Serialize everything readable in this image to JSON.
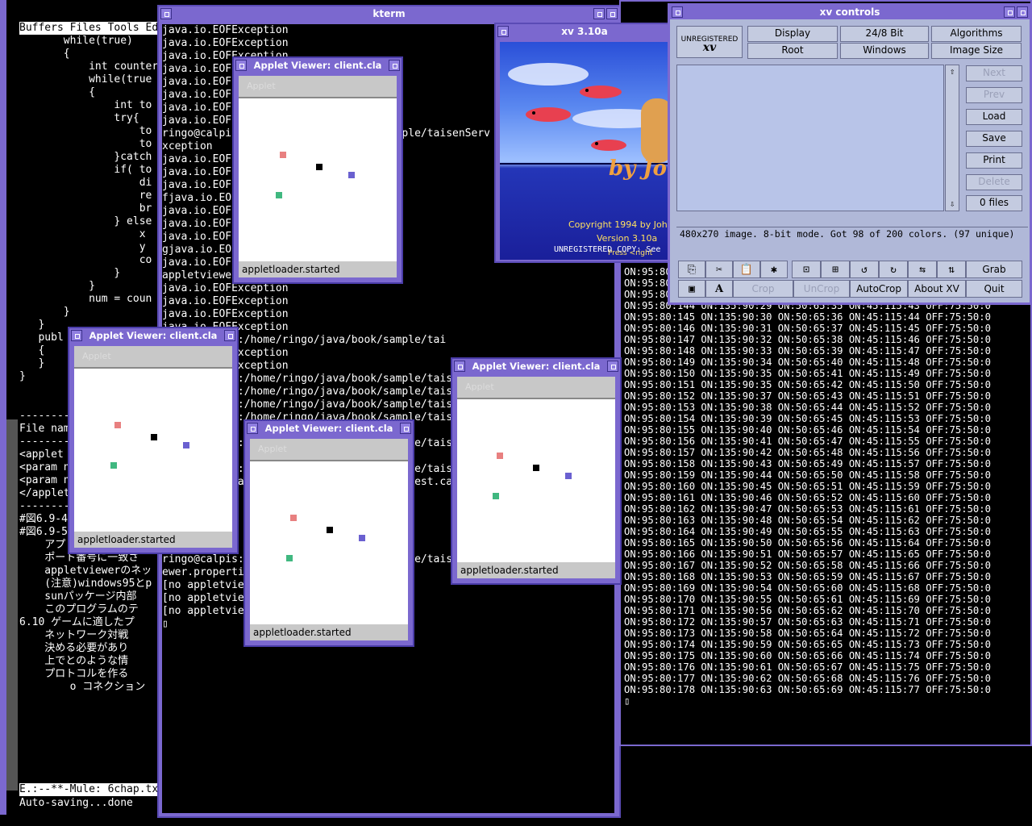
{
  "emacs": {
    "menubar": "Buffers Files Tools Edit",
    "code_lines": [
      "       while(true)",
      "       {",
      "           int counter",
      "           while(true",
      "           {",
      "               int to",
      "               try{",
      "                   to",
      "                   to",
      "               }catch",
      "",
      "               if( to",
      "                   di",
      "                   re",
      "                   br",
      "               } else",
      "                   x",
      "                   y",
      "                   co",
      "               }",
      "           }",
      "           num = coun",
      "       }",
      "   }",
      "   publ",
      "   {",
      "",
      "   }",
      "}"
    ],
    "lower_lines": [
      "----------",
      "File name",
      "----------",
      "<applet",
      "<param n",
      "<param n",
      "</applet",
      "----------",
      "#図6.9-4",
      "#図6.9-5",
      "",
      "    アプレットのparam",
      "    ポート番号に一致さ",
      "    appletviewerのネッ",
      "    (注意)windows95とp",
      "    sunパッケージ内部",
      "    このプログラムのテ",
      "",
      "",
      "",
      "6.10 ゲームに適したプ",
      "",
      "    ネットワーク対戦",
      "    決める必要があり",
      "    上でとのような情",
      "    プロトコルを作る",
      "",
      "        o コネクション"
    ],
    "modeline": "E.:--**-Mule: 6chap.tx",
    "minibuffer": "Auto-saving...done"
  },
  "kterm": {
    "title": "kterm",
    "lines": [
      "java.io.EOFException",
      "java.io.EOFException",
      "java.io.EOFException",
      "java.io.EOFException",
      "java.io.EOFException",
      "java.io.EOFException",
      "java.io.EOFException",
      "java.io.EOFException",
      "",
      "ringo@calpis:/home/ringo/java/book/sample/taisenServ",
      "xception",
      "java.io.EOFException",
      "java.io.EOFException",
      "java.io.EOFException",
      "fjava.io.EOFException",
      "java.io.EOFException",
      "java.io.EOFException",
      "java.io.EOFException",
      "gjava.io.EOFException",
      "java.io.EOFException",
      "",
      "appletviewer test.calpis.html",
      "java.io.EOFException",
      "java.io.EOFException",
      "java.io.EOFException",
      "java.io.EOFException",
      "ringo@calpis:/home/ringo/java/book/sample/tai",
      "",
      "java.io.EOFException",
      "java.io.EOFException",
      "",
      "",
      "",
      "",
      "",
      "",
      "",
      "",
      "",
      "",
      "ringo@calpis:/home/ringo/java/book/sample/taisenServCli",
      "ringo@calpis:/home/ringo/java/book/sample/taisenServCli",
      "ringo@calpis:/home/ringo/java/book/sample/taisenServCli % n client.ja",
      "ringo@calpis:/home/ringo/java/book/sample/taisenServCli % n client.ja",
      "a",
      "ringo@calpis:/home/ringo/java/book/sample/taisenServCli % jc client.j",
      "va",
      "ringo@calpis:/home/ringo/java/book/sample/taisenServCli % ap test.cal",
      "is.html & ; ap test.calpis.html & ; ap test.calpis.html & ap test.ca",
      "is.html &",
      "[1] 594",
      "[2] 595",
      "[3] 596",
      "[4] 597",
      "ringo@calpis:/home/ringo/java/book/sample/taisenServCli % [no applet",
      "ewer.properties file found!]",
      "[no appletviewer.properties file found!]",
      "[no appletviewer.properties file found!]",
      "[no appletviewer.properties file found!]",
      "▯"
    ]
  },
  "output_lines": [
    "ON:95:80:141 ON:135:90:27 ON:50:65:32 ON:45:115:40 OFF:75:50:0",
    "ON:95:80:142 ON:135:90:28 ON:50:65:33 ON:45:115:41 OFF:75:50:0",
    "ON:95:80:143 ON:135:90:29 ON:50:65:34 ON:45:115:42 OFF:75:50:0",
    "ON:95:80:144 ON:135:90:29 ON:50:65:35 ON:45:115:43 OFF:75:50:0",
    "ON:95:80:145 ON:135:90:30 ON:50:65:36 ON:45:115:44 OFF:75:50:0",
    "ON:95:80:146 ON:135:90:31 ON:50:65:37 ON:45:115:45 OFF:75:50:0",
    "ON:95:80:147 ON:135:90:32 ON:50:65:38 ON:45:115:46 OFF:75:50:0",
    "ON:95:80:148 ON:135:90:33 ON:50:65:39 ON:45:115:47 OFF:75:50:0",
    "ON:95:80:149 ON:135:90:34 ON:50:65:40 ON:45:115:48 OFF:75:50:0",
    "ON:95:80:150 ON:135:90:35 ON:50:65:41 ON:45:115:49 OFF:75:50:0",
    "ON:95:80:151 ON:135:90:35 ON:50:65:42 ON:45:115:50 OFF:75:50:0",
    "ON:95:80:152 ON:135:90:37 ON:50:65:43 ON:45:115:51 OFF:75:50:0",
    "ON:95:80:153 ON:135:90:38 ON:50:65:44 ON:45:115:52 OFF:75:50:0",
    "ON:95:80:154 ON:135:90:39 ON:50:65:45 ON:45:115:53 OFF:75:50:0",
    "ON:95:80:155 ON:135:90:40 ON:50:65:46 ON:45:115:54 OFF:75:50:0",
    "ON:95:80:156 ON:135:90:41 ON:50:65:47 ON:45:115:55 OFF:75:50:0",
    "ON:95:80:157 ON:135:90:42 ON:50:65:48 ON:45:115:56 OFF:75:50:0",
    "ON:95:80:158 ON:135:90:43 ON:50:65:49 ON:45:115:57 OFF:75:50:0",
    "ON:95:80:159 ON:135:90:44 ON:50:65:50 ON:45:115:58 OFF:75:50:0",
    "ON:95:80:160 ON:135:90:45 ON:50:65:51 ON:45:115:59 OFF:75:50:0",
    "ON:95:80:161 ON:135:90:46 ON:50:65:52 ON:45:115:60 OFF:75:50:0",
    "ON:95:80:162 ON:135:90:47 ON:50:65:53 ON:45:115:61 OFF:75:50:0",
    "ON:95:80:163 ON:135:90:48 ON:50:65:54 ON:45:115:62 OFF:75:50:0",
    "ON:95:80:164 ON:135:90:49 ON:50:65:55 ON:45:115:63 OFF:75:50:0",
    "ON:95:80:165 ON:135:90:50 ON:50:65:56 ON:45:115:64 OFF:75:50:0",
    "ON:95:80:166 ON:135:90:51 ON:50:65:57 ON:45:115:65 OFF:75:50:0",
    "ON:95:80:167 ON:135:90:52 ON:50:65:58 ON:45:115:66 OFF:75:50:0",
    "ON:95:80:168 ON:135:90:53 ON:50:65:59 ON:45:115:67 OFF:75:50:0",
    "ON:95:80:169 ON:135:90:54 ON:50:65:60 ON:45:115:68 OFF:75:50:0",
    "ON:95:80:170 ON:135:90:55 ON:50:65:61 ON:45:115:69 OFF:75:50:0",
    "ON:95:80:171 ON:135:90:56 ON:50:65:62 ON:45:115:70 OFF:75:50:0",
    "ON:95:80:172 ON:135:90:57 ON:50:65:63 ON:45:115:71 OFF:75:50:0",
    "ON:95:80:173 ON:135:90:58 ON:50:65:64 ON:45:115:72 OFF:75:50:0",
    "ON:95:80:174 ON:135:90:59 ON:50:65:65 ON:45:115:73 OFF:75:50:0",
    "ON:95:80:175 ON:135:90:60 ON:50:65:66 ON:45:115:74 OFF:75:50:0",
    "ON:95:80:176 ON:135:90:61 ON:50:65:67 ON:45:115:75 OFF:75:50:0",
    "ON:95:80:177 ON:135:90:62 ON:50:65:68 ON:45:115:76 OFF:75:50:0",
    "ON:95:80:178 ON:135:90:63 ON:50:65:69 ON:45:115:77 OFF:75:50:0",
    "▯"
  ],
  "xv_about": {
    "title": "xv 3.10a",
    "byline": "by John",
    "copyright": "Copyright 1994 by John",
    "version": "Version 3.10a",
    "press": "Press <right",
    "unregistered": "UNREGISTERED COPY:  See"
  },
  "xv_controls": {
    "title": "xv controls",
    "logo_label": "UNREGISTERED",
    "menu_buttons": [
      "Display",
      "24/8 Bit",
      "Algorithms",
      "Root",
      "Windows",
      "Image Size"
    ],
    "side_buttons": [
      "Next",
      "Prev",
      "Load",
      "Save",
      "Print",
      "Delete",
      "0 files"
    ],
    "status": "480x270 image.  8-bit mode.  Got 98 of 200 colors.  (97 unique)",
    "bottom_labels": {
      "grab": "Grab",
      "crop": "Crop",
      "uncrop": "UnCrop",
      "autocrop": "AutoCrop",
      "about": "About XV",
      "quit": "Quit",
      "text_tool": "A"
    },
    "icon_glyphs": {
      "copy": "⎘",
      "cut": "✂",
      "paste": "📋",
      "clear": "✱",
      "shrink": "⊡",
      "expand": "⊞",
      "rotl": "↺",
      "rotr": "↻",
      "fliph": "⇆",
      "flipv": "⇅",
      "pad": "▣"
    }
  },
  "applets": [
    {
      "title": "Applet Viewer: client.cla",
      "menu": "Applet",
      "status": "appletloader.started"
    },
    {
      "title": "Applet Viewer: client.cla",
      "menu": "Applet",
      "status": "appletloader.started"
    },
    {
      "title": "Applet Viewer: client.cla",
      "menu": "Applet",
      "status": "appletloader.started"
    },
    {
      "title": "Applet Viewer: client.cla",
      "menu": "Applet",
      "status": "appletloader.started"
    }
  ]
}
